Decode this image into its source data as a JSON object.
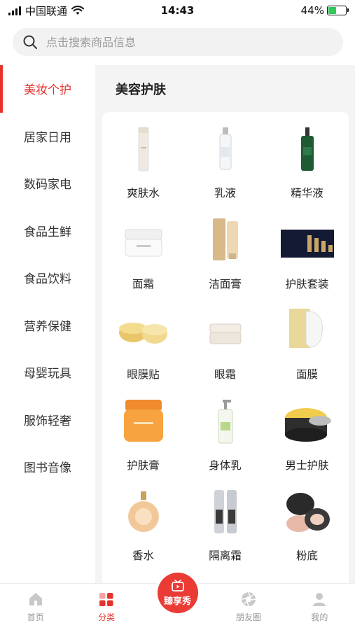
{
  "status": {
    "carrier": "中国联通",
    "time": "14:43",
    "battery": "44%",
    "battery_level": 0.44
  },
  "search": {
    "placeholder": "点击搜索商品信息"
  },
  "sidebar": {
    "items": [
      {
        "label": "美妆个护",
        "active": true
      },
      {
        "label": "居家日用"
      },
      {
        "label": "数码家电"
      },
      {
        "label": "食品生鲜"
      },
      {
        "label": "食品饮料"
      },
      {
        "label": "营养保健"
      },
      {
        "label": "母婴玩具"
      },
      {
        "label": "服饰轻奢"
      },
      {
        "label": "图书音像"
      }
    ]
  },
  "subcategory": {
    "title": "美容护肤"
  },
  "products": [
    {
      "label": "爽肤水",
      "icon": "toner-bottle-icon"
    },
    {
      "label": "乳液",
      "icon": "lotion-bottle-icon"
    },
    {
      "label": "精华液",
      "icon": "serum-bottle-icon"
    },
    {
      "label": "面霜",
      "icon": "cream-jar-icon"
    },
    {
      "label": "洁面膏",
      "icon": "cleanser-tube-icon"
    },
    {
      "label": "护肤套装",
      "icon": "skincare-set-icon"
    },
    {
      "label": "眼膜贴",
      "icon": "eye-mask-jars-icon"
    },
    {
      "label": "眼霜",
      "icon": "eye-cream-jar-icon"
    },
    {
      "label": "面膜",
      "icon": "face-mask-icon"
    },
    {
      "label": "护肤膏",
      "icon": "orange-jar-icon"
    },
    {
      "label": "身体乳",
      "icon": "body-lotion-icon"
    },
    {
      "label": "男士护肤",
      "icon": "mens-skincare-icon"
    },
    {
      "label": "香水",
      "icon": "perfume-bottle-icon"
    },
    {
      "label": "隔离霜",
      "icon": "primer-bottles-icon"
    },
    {
      "label": "粉底",
      "icon": "cushion-compact-icon"
    }
  ],
  "tabbar": {
    "home": "首页",
    "category": "分类",
    "center": "臻享秀",
    "moments": "朋友圈",
    "mine": "我的"
  },
  "colors": {
    "accent": "#e6322c",
    "panel_bg": "#f4f4f4"
  }
}
